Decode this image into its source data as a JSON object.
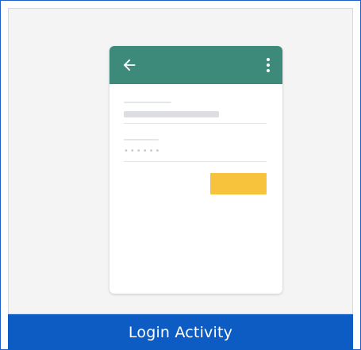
{
  "template": {
    "caption": "Login Activity",
    "icons": {
      "back": "arrow-left-icon",
      "menu": "more-vert-icon"
    },
    "colors": {
      "frame_border": "#1e62c9",
      "caption_bar": "#0d5cc4",
      "app_bar": "#3d8a7a",
      "login_button": "#f7c23c",
      "preview_background": "#f4f4f5"
    },
    "password_placeholder": "••••••"
  }
}
